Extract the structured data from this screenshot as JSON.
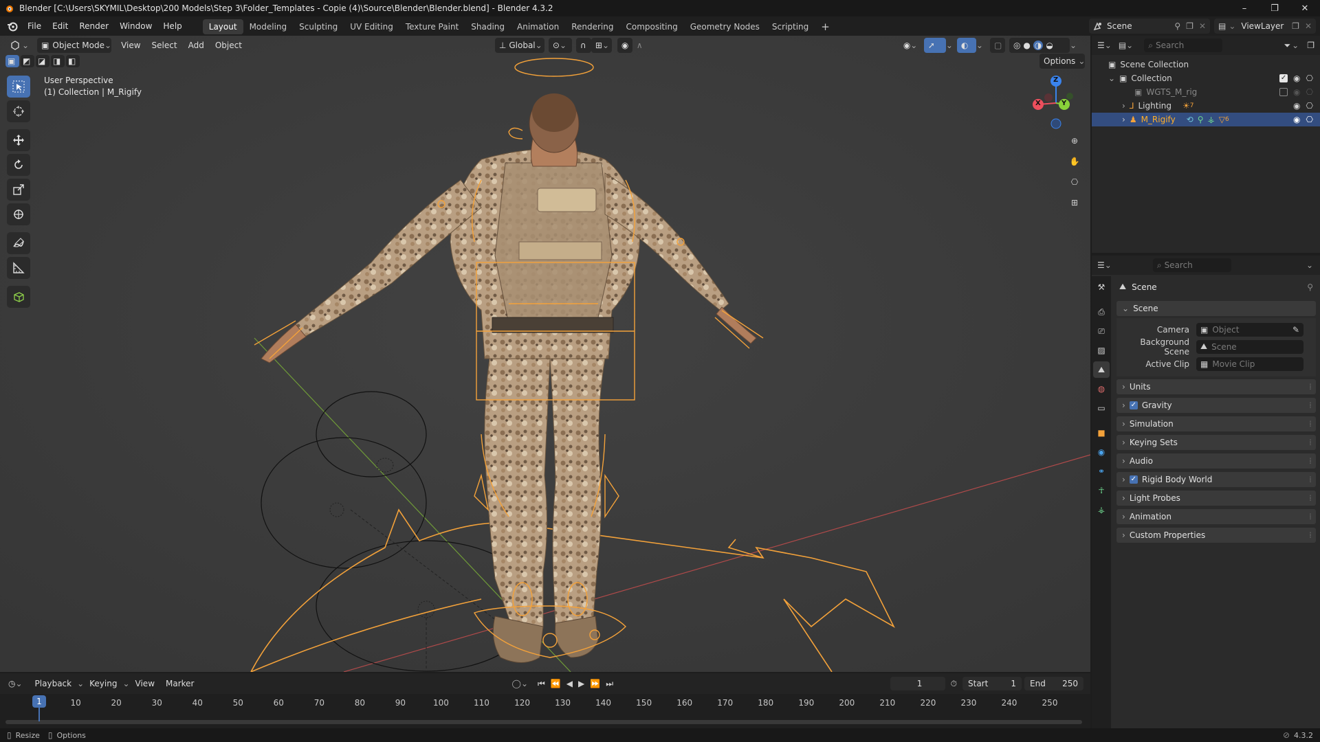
{
  "window": {
    "title": "Blender [C:\\Users\\SKYMIL\\Desktop\\200 Models\\Step 3\\Folder_Templates - Copie (4)\\Source\\Blender\\Blender.blend] - Blender 4.3.2",
    "minimize": "–",
    "maximize": "❐",
    "close": "✕"
  },
  "menu": [
    "File",
    "Edit",
    "Render",
    "Window",
    "Help"
  ],
  "workspaces": [
    "Layout",
    "Modeling",
    "Sculpting",
    "UV Editing",
    "Texture Paint",
    "Shading",
    "Animation",
    "Rendering",
    "Compositing",
    "Geometry Nodes",
    "Scripting"
  ],
  "active_workspace": "Layout",
  "add_workspace": "+",
  "scene_selector": {
    "scene": "Scene",
    "view_layer": "ViewLayer"
  },
  "viewport_header": {
    "mode": "Object Mode",
    "menus": [
      "View",
      "Select",
      "Add",
      "Object"
    ],
    "transform_orientation": "Global",
    "options": "Options"
  },
  "viewport": {
    "view_name": "User Perspective",
    "collection_info": "(1) Collection | M_Rigify",
    "gizmo": {
      "x": "X",
      "y": "Y",
      "z": "Z"
    },
    "colors": {
      "accent": "#4772b3",
      "rig_orange": "#f4a23a",
      "grid_red": "#b04a4a",
      "grid_green": "#6f9b38",
      "gizmo_x": "#ed4f5d",
      "gizmo_y": "#89d23a",
      "gizmo_z": "#3a83ed"
    }
  },
  "outliner": {
    "search_placeholder": "Search",
    "items": [
      {
        "label": "Scene Collection",
        "level": 0
      },
      {
        "label": "Collection",
        "level": 1
      },
      {
        "label": "WGTS_M_rig",
        "level": 2
      },
      {
        "label": "Lighting",
        "level": 2,
        "badge": "7"
      },
      {
        "label": "M_Rigify",
        "level": 2,
        "badge": "6",
        "selected": true
      }
    ]
  },
  "properties": {
    "search_placeholder": "Search",
    "context": "Scene",
    "scene_panel": {
      "title": "Scene",
      "fields": [
        {
          "label": "Camera",
          "value": "Object"
        },
        {
          "label": "Background Scene",
          "value": "Scene"
        },
        {
          "label": "Active Clip",
          "value": "Movie Clip"
        }
      ]
    },
    "panels": [
      {
        "label": "Units",
        "checkbox": false
      },
      {
        "label": "Gravity",
        "checkbox": true
      },
      {
        "label": "Simulation",
        "checkbox": false
      },
      {
        "label": "Keying Sets",
        "checkbox": false
      },
      {
        "label": "Audio",
        "checkbox": false
      },
      {
        "label": "Rigid Body World",
        "checkbox": true
      },
      {
        "label": "Light Probes",
        "checkbox": false
      },
      {
        "label": "Animation",
        "checkbox": false
      },
      {
        "label": "Custom Properties",
        "checkbox": false
      }
    ]
  },
  "timeline": {
    "menus": [
      "Playback",
      "Keying",
      "View",
      "Marker"
    ],
    "current_frame": "1",
    "start_label": "Start",
    "start": "1",
    "end_label": "End",
    "end": "250",
    "ticks": [
      "1",
      "10",
      "20",
      "30",
      "40",
      "50",
      "60",
      "70",
      "80",
      "90",
      "100",
      "110",
      "120",
      "130",
      "140",
      "150",
      "160",
      "170",
      "180",
      "190",
      "200",
      "210",
      "220",
      "230",
      "240",
      "250"
    ]
  },
  "statusbar": {
    "left1": "Resize",
    "left2": "Options",
    "version": "4.3.2"
  }
}
